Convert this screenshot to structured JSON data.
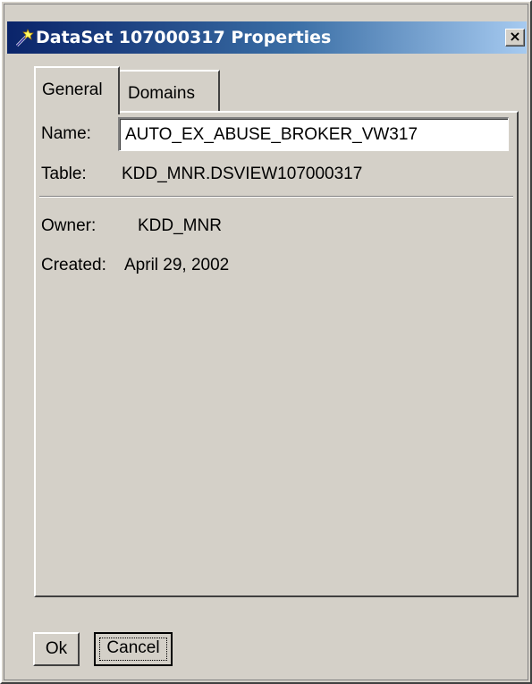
{
  "titlebar": {
    "title": "DataSet 107000317 Properties",
    "icon": "dataset-wand-icon",
    "close_label": "×"
  },
  "tabs": [
    {
      "label": "General",
      "selected": true
    },
    {
      "label": "Domains",
      "selected": false
    }
  ],
  "general": {
    "name_label": "Name:",
    "name_value": "AUTO_EX_ABUSE_BROKER_VW317",
    "table_label": "Table:",
    "table_value": "KDD_MNR.DSVIEW107000317",
    "owner_label": "Owner:",
    "owner_value": "KDD_MNR",
    "created_label": "Created:",
    "created_value": "April 29, 2002"
  },
  "buttons": {
    "ok_label": "Ok",
    "cancel_label": "Cancel"
  },
  "colors": {
    "titlebar_start": "#0a246a",
    "titlebar_end": "#a6caf0",
    "dialog_face": "#d4d0c8"
  }
}
